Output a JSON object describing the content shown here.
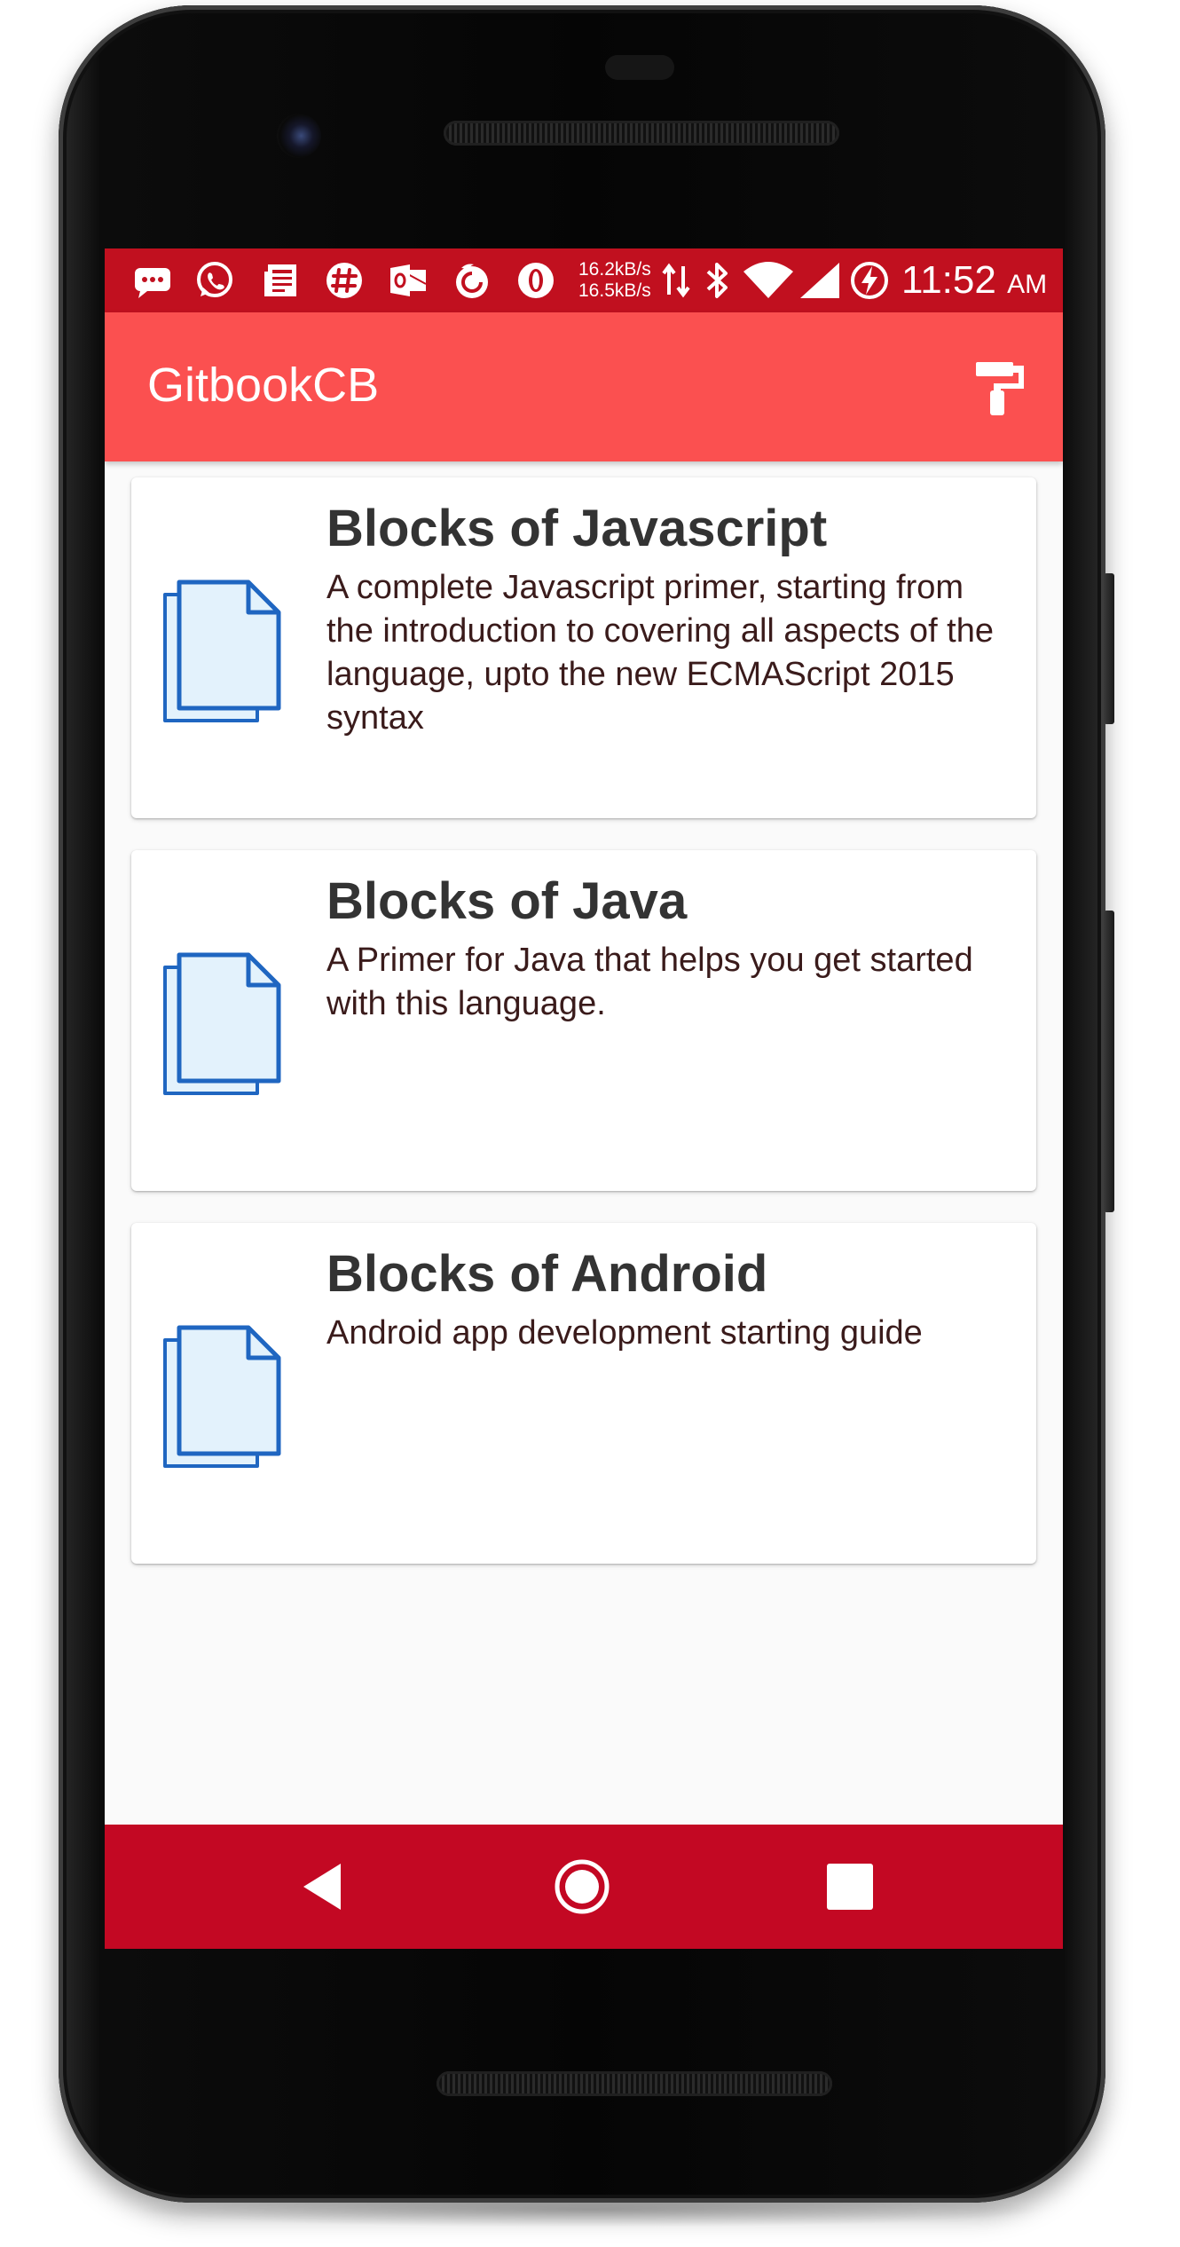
{
  "device": {
    "name": "Android phone"
  },
  "status_bar": {
    "icons": [
      "message-icon",
      "whatsapp-icon",
      "news-icon",
      "slack-icon",
      "outlook-icon",
      "firefox-icon",
      "opera-icon",
      "data-transfer-icon",
      "bluetooth-icon",
      "wifi-icon",
      "cellular-signal-icon",
      "battery-charging-icon"
    ],
    "upload_speed": "16.2kB/s",
    "download_speed": "16.5kB/s",
    "time": "11:52",
    "ampm": "AM"
  },
  "app_bar": {
    "title": "GitbookCB",
    "action_icon": "paint-roller-icon"
  },
  "books": [
    {
      "title": "Blocks of Javascript",
      "description": "A complete Javascript primer, starting from the introduction to covering all aspects of the language, upto the new ECMAScript 2015 syntax",
      "icon": "document-copies-icon"
    },
    {
      "title": "Blocks of Java",
      "description": "A Primer for Java that helps you get started with this language.",
      "icon": "document-copies-icon"
    },
    {
      "title": "Blocks of Android",
      "description": "Android app development starting guide",
      "icon": "document-copies-icon"
    }
  ],
  "nav_bar": {
    "buttons": [
      "back-icon",
      "home-icon",
      "recents-icon"
    ]
  },
  "colors": {
    "status_bar": "#c1101f",
    "app_bar": "#fb5050",
    "nav_bar": "#c30823",
    "card_title": "#333333",
    "card_description": "#3a1b1b",
    "icon_stroke": "#1f66c1",
    "icon_fill": "#e3f2fc"
  }
}
